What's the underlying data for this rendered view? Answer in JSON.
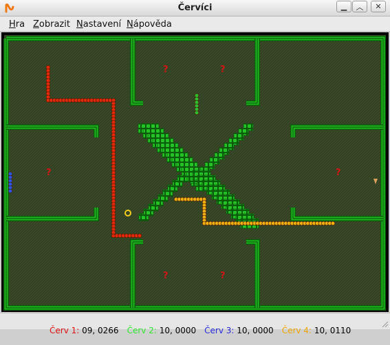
{
  "window": {
    "title": "Červíci"
  },
  "menu": [
    {
      "mnemonic": "H",
      "rest": "ra"
    },
    {
      "mnemonic": "Z",
      "rest": "obrazit"
    },
    {
      "mnemonic": "N",
      "rest": "astavení"
    },
    {
      "mnemonic": "N",
      "rest": "ápověda"
    }
  ],
  "status": [
    {
      "label": "Červ 1:",
      "value": "09, 0266",
      "color": "#e01010"
    },
    {
      "label": "Červ 2:",
      "value": "10, 0000",
      "color": "#2ee82e"
    },
    {
      "label": "Červ 3:",
      "value": "10, 0000",
      "color": "#2828dc"
    },
    {
      "label": "Červ 4:",
      "value": "10, 0110",
      "color": "#f0a500"
    }
  ],
  "board": {
    "colors": {
      "wall": "#1fb81f",
      "wall_dark": "#0a5c0a",
      "floor": "#3a4a28",
      "red_worm": "#e02a0a",
      "green_worm": "#2fbf2f",
      "blue_worm": "#2a55dd",
      "yellow_worm": "#f0b010",
      "bonus_question": "#d01515"
    },
    "items": [
      "question-bonus",
      "question-bonus",
      "question-bonus",
      "question-bonus",
      "question-bonus",
      "question-bonus",
      "question-bonus",
      "question-bonus",
      "ring-bonus",
      "cone-bonus"
    ]
  }
}
